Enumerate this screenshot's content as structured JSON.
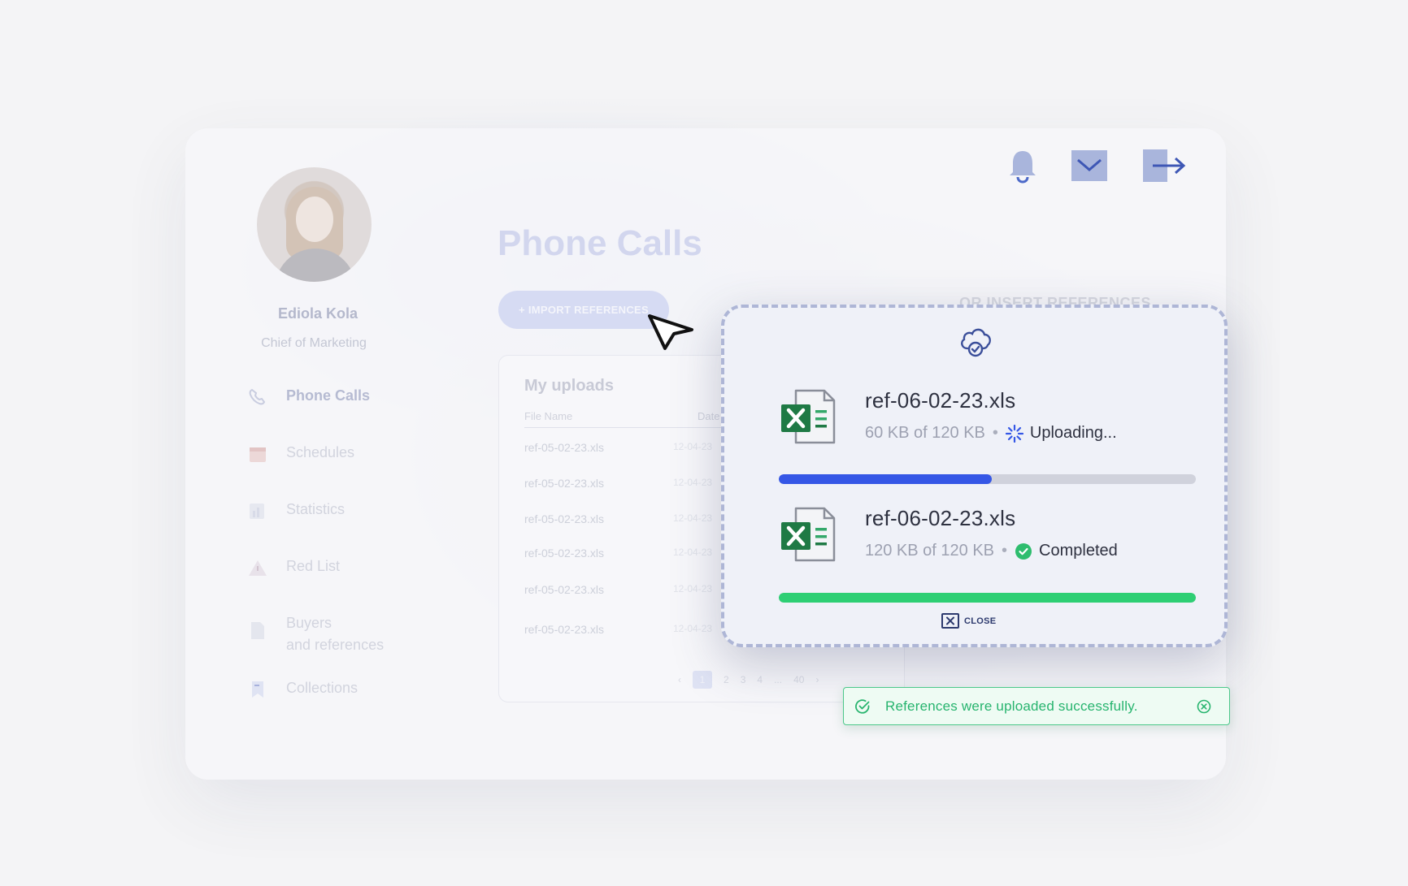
{
  "sidebar": {
    "user_name": "Ediola Kola",
    "user_role": "Chief of Marketing",
    "items": [
      {
        "label": "Phone Calls",
        "icon": "phone-icon"
      },
      {
        "label": "Schedules",
        "icon": "calendar-icon"
      },
      {
        "label": "Statistics",
        "icon": "chart-icon"
      },
      {
        "label": "Red List",
        "icon": "warning-icon"
      },
      {
        "label": "Buyers",
        "label2": "and references",
        "icon": "document-icon"
      },
      {
        "label": "Collections",
        "icon": "bookmark-icon"
      }
    ]
  },
  "header": {
    "icons": [
      "bell-icon",
      "mail-icon",
      "logout-icon"
    ]
  },
  "main": {
    "title": "Phone Calls",
    "import_button": "+ IMPORT REFERENCES",
    "insert_label": "OR INSERT REFERENCES",
    "uploads": {
      "title": "My uploads",
      "columns": [
        "File Name",
        "Date"
      ],
      "rows": [
        {
          "name": "ref-05-02-23.xls",
          "date": "12-04-23"
        },
        {
          "name": "ref-05-02-23.xls",
          "date": "12-04-23"
        },
        {
          "name": "ref-05-02-23.xls",
          "date": "12-04-23"
        },
        {
          "name": "ref-05-02-23.xls",
          "date": "12-04-23"
        },
        {
          "name": "ref-05-02-23.xls",
          "date": "12-04-23"
        },
        {
          "name": "ref-05-02-23.xls",
          "date": "12-04-23"
        }
      ],
      "pager": {
        "prev": "‹",
        "pages": [
          "1",
          "2",
          "3",
          "4",
          "...",
          "40"
        ],
        "next": "›",
        "current": "1"
      }
    }
  },
  "modal": {
    "icon": "cloud-check-icon",
    "files": [
      {
        "name": "ref-06-02-23.xls",
        "size": "60 KB of 120 KB",
        "separator": "•",
        "status": "Uploading...",
        "status_icon": "spinner-icon",
        "progress": 0.51,
        "color": "#3557e6"
      },
      {
        "name": "ref-06-02-23.xls",
        "size": "120 KB of 120 KB",
        "separator": "•",
        "status": "Completed",
        "status_icon": "check-circle-icon",
        "progress": 1.0,
        "color": "#2ecf74"
      }
    ],
    "close_label": "CLOSE"
  },
  "toast": {
    "message": "References were uploaded successfully.",
    "color": "#27b46e"
  }
}
